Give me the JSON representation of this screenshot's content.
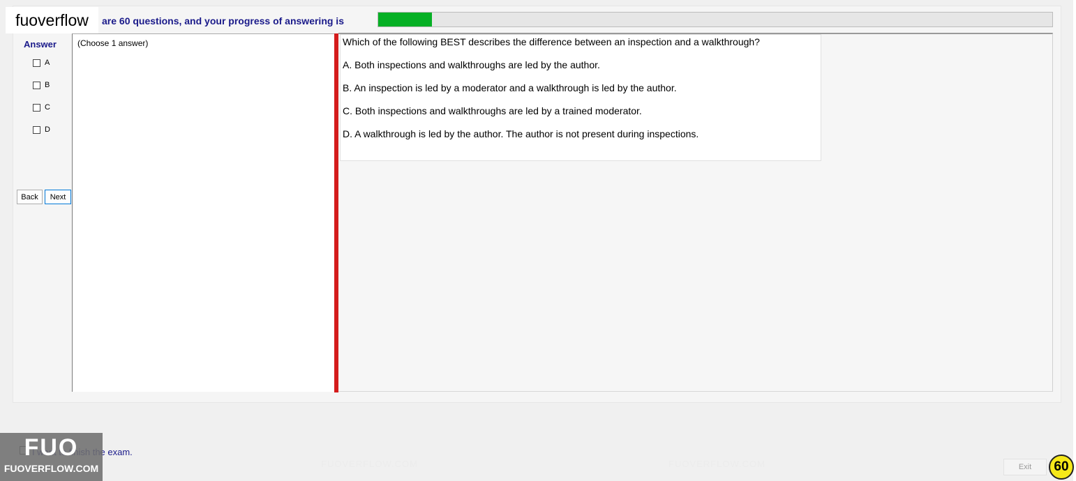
{
  "brand": {
    "logo_text": "fuoverflow",
    "badge_big": "FUO",
    "badge_small": "FUOVERFLOW.COM"
  },
  "header": {
    "progress_text": "are 60 questions, and your progress of answering is",
    "progress_fraction": 0.08
  },
  "answer_panel": {
    "title": "Answer",
    "options": [
      "A",
      "B",
      "C",
      "D"
    ],
    "back_label": "Back",
    "next_label": "Next"
  },
  "left_panel": {
    "instruction": "(Choose 1 answer)"
  },
  "question": {
    "text": "Which of the following BEST describes the difference between an inspection and a walkthrough?",
    "choices": [
      "A.  Both inspections and walkthroughs are led by the author.",
      "B.  An inspection is led by a moderator and a walkthrough is led by the author.",
      "C.  Both inspections and walkthroughs are led by a trained moderator.",
      "D.  A walkthrough is led by the author. The author is not present during inspections."
    ]
  },
  "watermark_text": "FUOVERFLOW.COM",
  "footer": {
    "finish_text": "I want to finish the exam.",
    "exit_label": "Exit",
    "timer_value": "60"
  }
}
